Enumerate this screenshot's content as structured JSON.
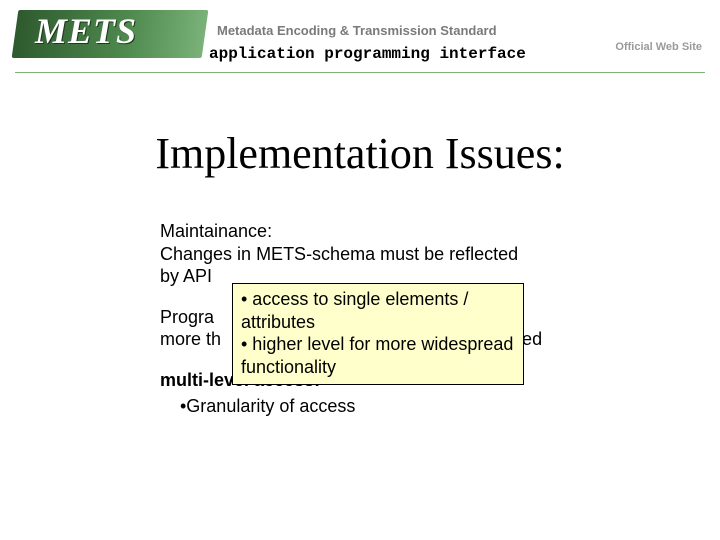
{
  "header": {
    "logo_text": "METS",
    "tagline": "Metadata Encoding & Transmission Standard",
    "api_label": "application programming interface",
    "site_label": "Official Web Site"
  },
  "title": "Implementation Issues:",
  "content": {
    "para1_line1": "Maintainance:",
    "para1_line2": "Changes in METS-schema must be reflected",
    "para1_line3": "by API",
    "para2_line1_prefix": "Progra",
    "para2_line2_prefix": "more th",
    "para2_line2_suffix": "rted",
    "heading3": "multi-level access:",
    "bullet3": "•Granularity of access"
  },
  "callout": {
    "b1": "• access to single elements / attributes",
    "b2": "• higher level for more widespread functionality"
  }
}
